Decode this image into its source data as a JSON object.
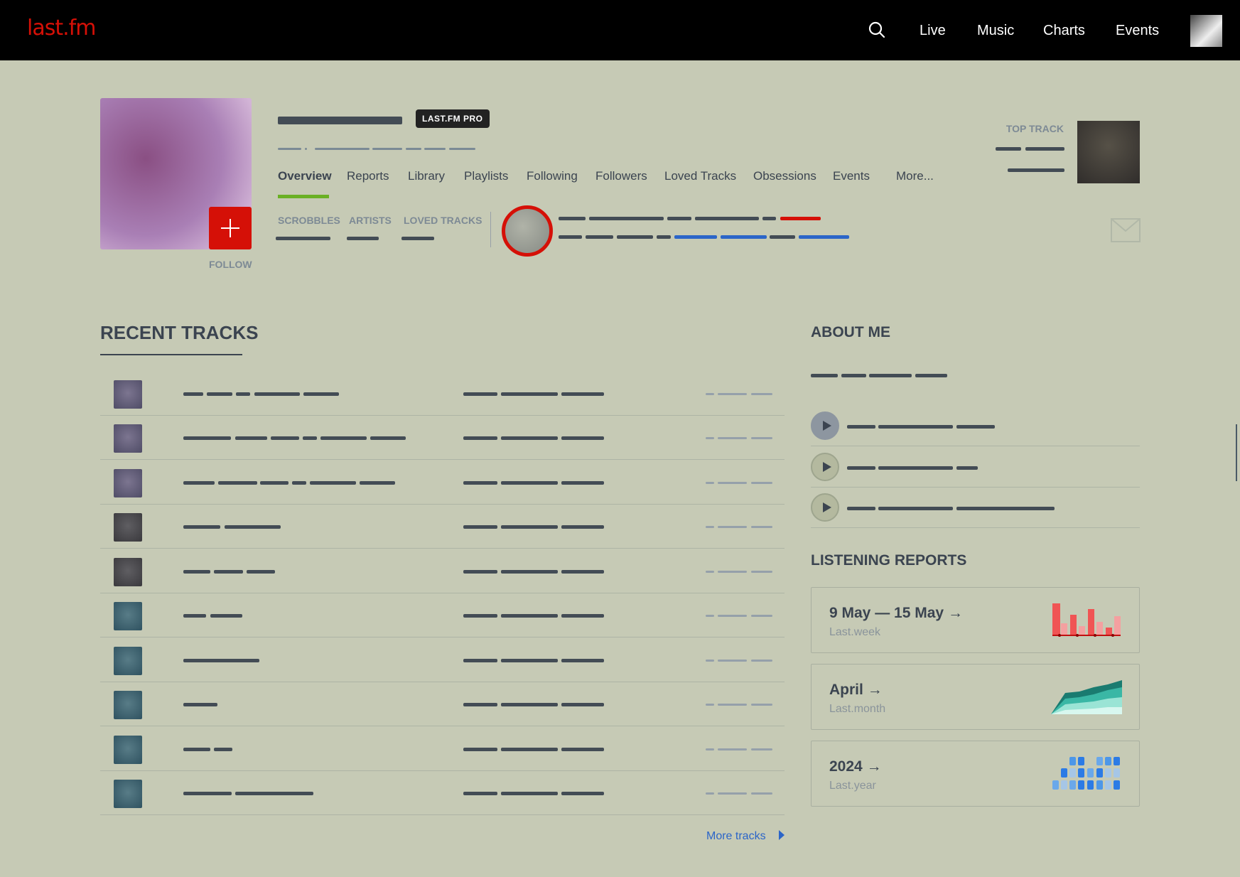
{
  "nav": {
    "logo": "last.fm",
    "links": [
      "Live",
      "Music",
      "Charts",
      "Events"
    ]
  },
  "profile": {
    "badge": "LAST.FM PRO",
    "follow_label": "FOLLOW",
    "tabs": [
      "Overview",
      "Reports",
      "Library",
      "Playlists",
      "Following",
      "Followers",
      "Loved Tracks",
      "Obsessions",
      "Events",
      "More..."
    ],
    "active_tab": "Overview",
    "stats": [
      "SCROBBLES",
      "ARTISTS",
      "LOVED TRACKS"
    ],
    "top_track_label": "TOP TRACK"
  },
  "recent_tracks": {
    "title": "RECENT TRACKS",
    "more_label": "More tracks"
  },
  "about": {
    "title": "ABOUT ME"
  },
  "reports": {
    "title": "LISTENING REPORTS",
    "cards": [
      {
        "title": "9 May — 15 May",
        "subtitle": "Last.week"
      },
      {
        "title": "April",
        "subtitle": "Last.month"
      },
      {
        "title": "2024",
        "subtitle": "Last.year"
      }
    ]
  },
  "colors": {
    "brand": "#d51007",
    "background": "#c6cab5",
    "accent_green": "#6ab024",
    "link_blue": "#2b65c8"
  },
  "icons": [
    "search-icon",
    "plus-icon",
    "mail-icon",
    "play-icon",
    "arrow-right-icon",
    "chevron-right-icon"
  ]
}
